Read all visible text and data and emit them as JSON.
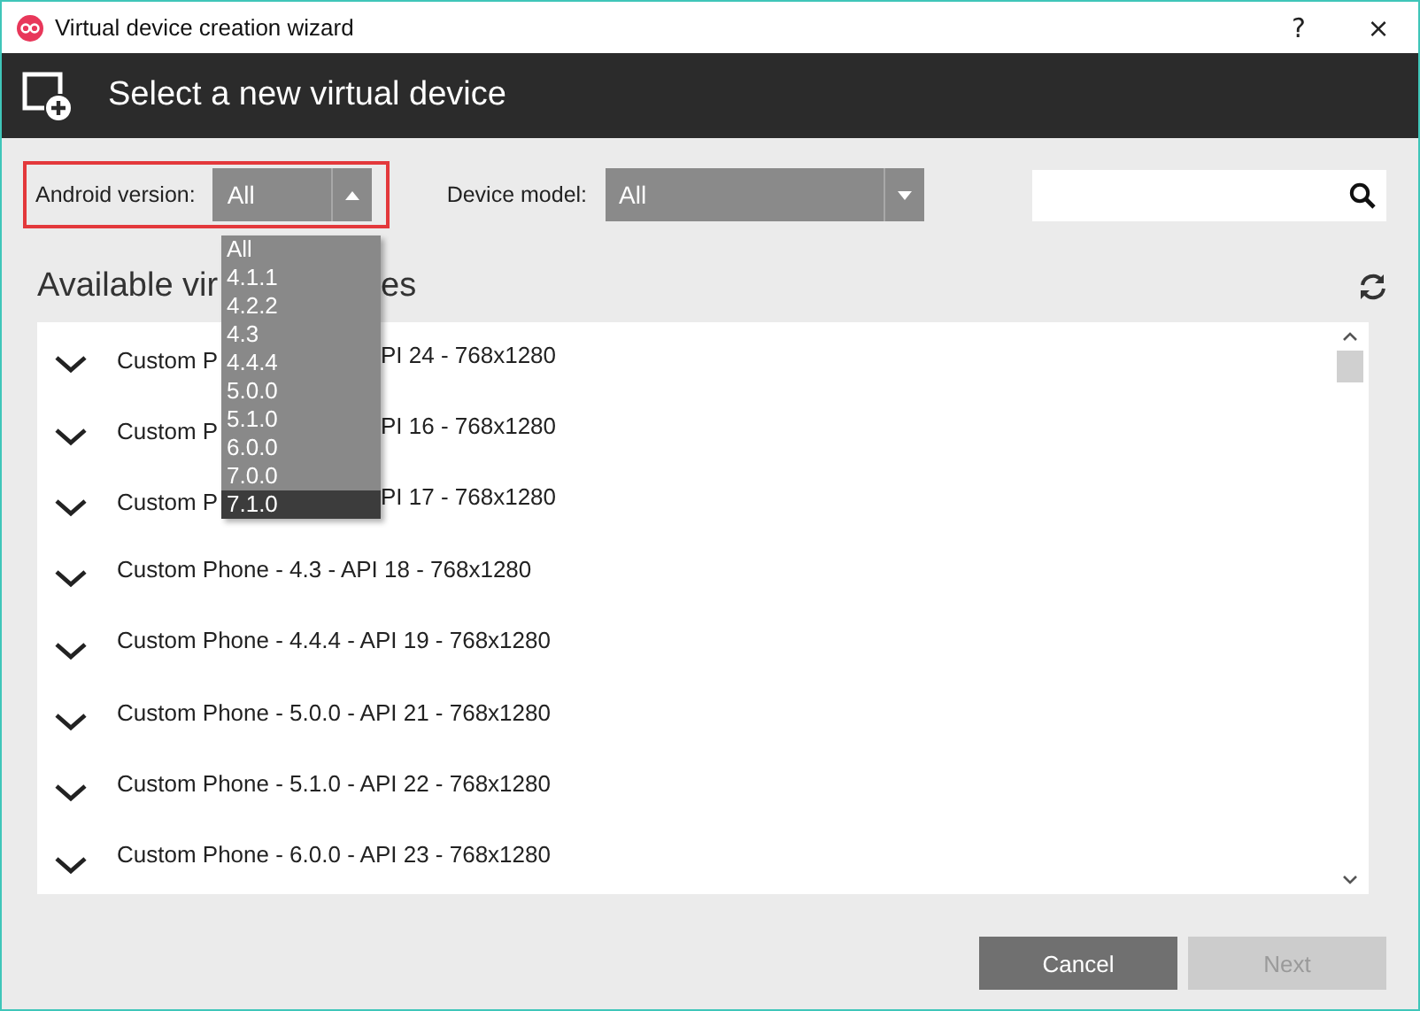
{
  "window": {
    "title": "Virtual device creation wizard",
    "controls": [
      "?",
      "×"
    ]
  },
  "header": {
    "title": "Select a new virtual device"
  },
  "filters": [
    {
      "label": "Android version:",
      "value": "All",
      "highlighted": true
    },
    {
      "label": "Device model:",
      "value": "All",
      "highlighted": false
    }
  ],
  "dropdown": {
    "items": [
      {
        "label": "All",
        "selected": false
      },
      {
        "label": "4.1.1",
        "selected": false
      },
      {
        "label": "4.2.2",
        "selected": false
      },
      {
        "label": "4.3",
        "selected": false
      },
      {
        "label": "4.4.4",
        "selected": false
      },
      {
        "label": "5.0.0",
        "selected": false
      },
      {
        "label": "5.1.0",
        "selected": false
      },
      {
        "label": "6.0.0",
        "selected": false
      },
      {
        "label": "7.0.0",
        "selected": false
      },
      {
        "label": "7.1.0",
        "selected": true
      }
    ]
  },
  "section": {
    "title_left": "Available vir",
    "title_right": "es"
  },
  "devices": [
    {
      "left": "Custom P",
      "right": "PI 24 - 768x1280"
    },
    {
      "left": "Custom P",
      "right": "PI 16 - 768x1280"
    },
    {
      "left": "Custom P",
      "right": "PI 17 - 768x1280"
    },
    {
      "name": "Custom Phone - 4.3 - API 18 - 768x1280"
    },
    {
      "name": "Custom Phone - 4.4.4 - API 19 - 768x1280"
    },
    {
      "name": "Custom Phone - 5.0.0 - API 21 - 768x1280"
    },
    {
      "name": "Custom Phone - 5.1.0 - API 22 - 768x1280"
    },
    {
      "name": "Custom Phone - 6.0.0 - API 23 - 768x1280"
    }
  ],
  "buttons": [
    {
      "label": "Cancel",
      "disabled": false
    },
    {
      "label": "Next",
      "disabled": true
    }
  ]
}
